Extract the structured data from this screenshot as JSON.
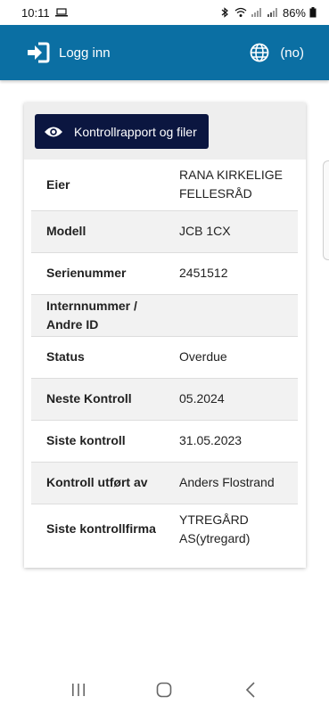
{
  "status_bar": {
    "time": "10:11",
    "battery": "86%",
    "icons": [
      "laptop-icon",
      "bluetooth-icon",
      "wifi-icon",
      "signal-icon",
      "signal-icon",
      "battery-icon"
    ]
  },
  "app_bar": {
    "login_label": "Logg inn",
    "login_icon": "login-icon",
    "language_icon": "globe-icon",
    "language_label": "(no)",
    "color": "#0b6fa3"
  },
  "card": {
    "report_button_label": "Kontrollrapport og filer",
    "report_button_icon": "eye-icon",
    "button_color": "#0b1640",
    "rows": [
      {
        "key": "Eier",
        "value": "RANA KIRKELIGE FELLESRÅD"
      },
      {
        "key": "Modell",
        "value": "JCB 1CX"
      },
      {
        "key": "Serienummer",
        "value": "2451512"
      },
      {
        "key": "Internnummer / Andre ID",
        "value": ""
      },
      {
        "key": "Status",
        "value": "Overdue"
      },
      {
        "key": "Neste Kontroll",
        "value": "05.2024"
      },
      {
        "key": "Siste kontroll",
        "value": "31.05.2023"
      },
      {
        "key": "Kontroll utført av",
        "value": "Anders Flostrand"
      },
      {
        "key": "Siste kontrollfirma",
        "value": "YTREGÅRD AS(ytregard)"
      }
    ]
  },
  "nav_bar": {
    "icons": [
      "recent-apps-icon",
      "home-icon",
      "back-icon"
    ]
  }
}
